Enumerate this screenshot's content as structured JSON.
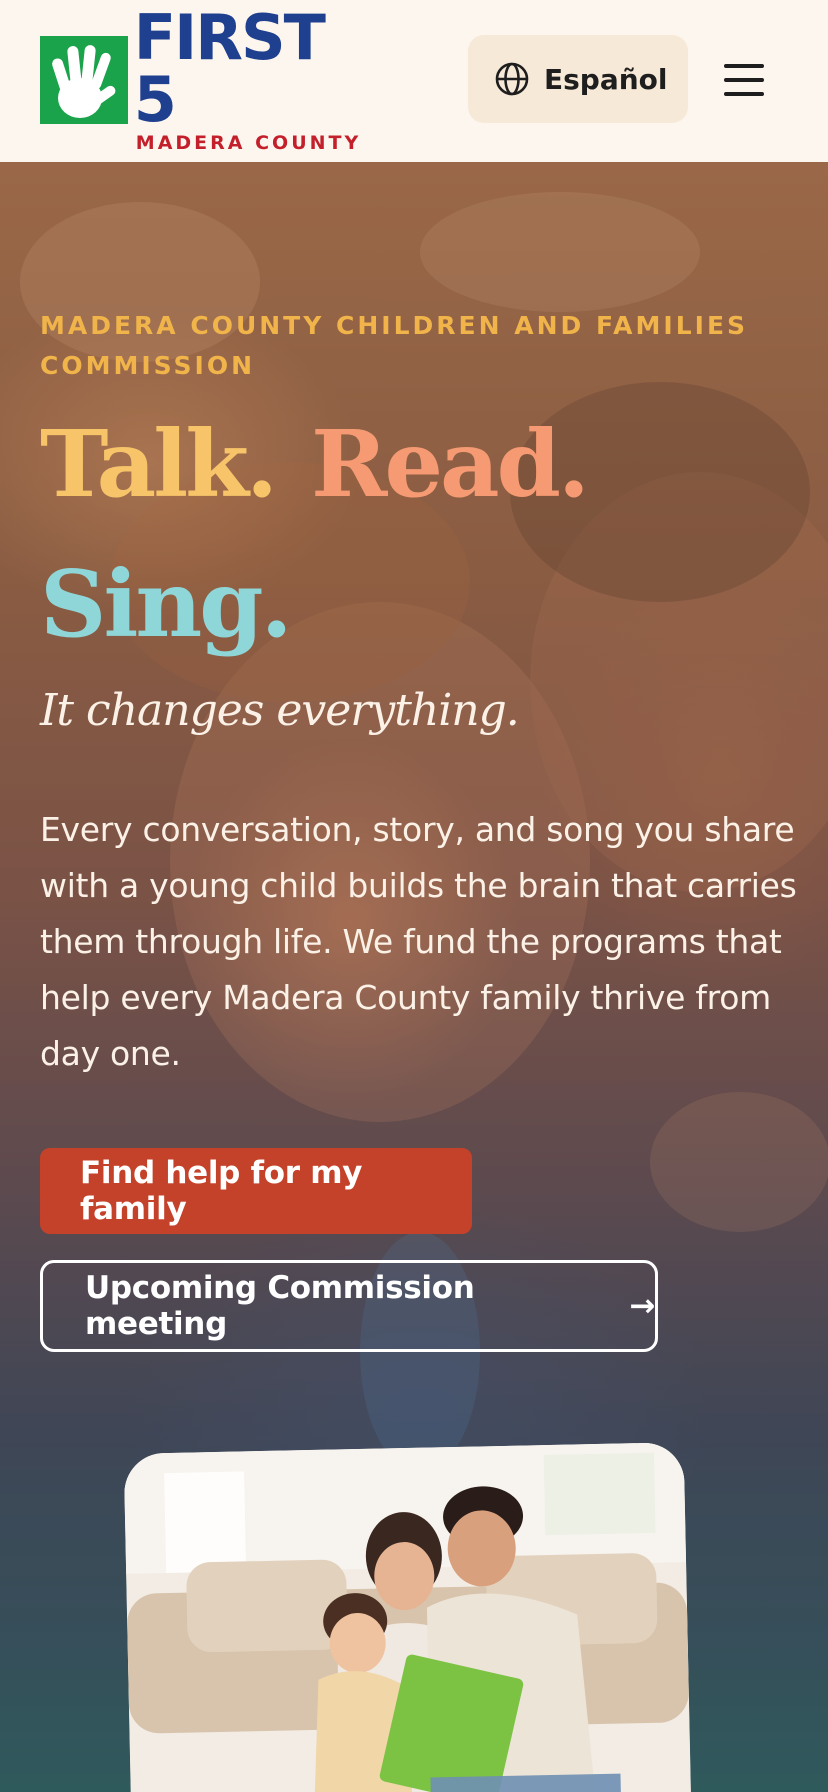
{
  "header": {
    "logo": {
      "primary_text": "FIRST 5",
      "secondary_text": "MADERA COUNTY",
      "icon": "hand-icon"
    },
    "language_button": {
      "label": "Español",
      "icon": "globe-icon"
    },
    "menu_button": {
      "icon": "hamburger-menu-icon"
    }
  },
  "hero": {
    "eyebrow": "MADERA COUNTY CHILDREN AND FAMILIES COMMISSION",
    "headline": {
      "word1": "Talk.",
      "word2": "Read.",
      "word3": "Sing."
    },
    "tagline": "It changes everything.",
    "body": "Every conversation, story, and song you share with a young child builds the brain that carries them through life. We fund the programs that help every Madera County family thrive from day one.",
    "primary_cta": "Find help for my family",
    "secondary_cta": "Upcoming Commission meeting",
    "secondary_cta_arrow": "→"
  },
  "colors": {
    "header_bg": "#fdf6ee",
    "logo_green": "#1aa34a",
    "logo_blue": "#1f3f8f",
    "logo_red": "#c3202b",
    "eyebrow": "#f0b44a",
    "talk": "#f7c46a",
    "read": "#f59a72",
    "sing": "#8fd6d8",
    "primary_button": "#c4422a"
  }
}
